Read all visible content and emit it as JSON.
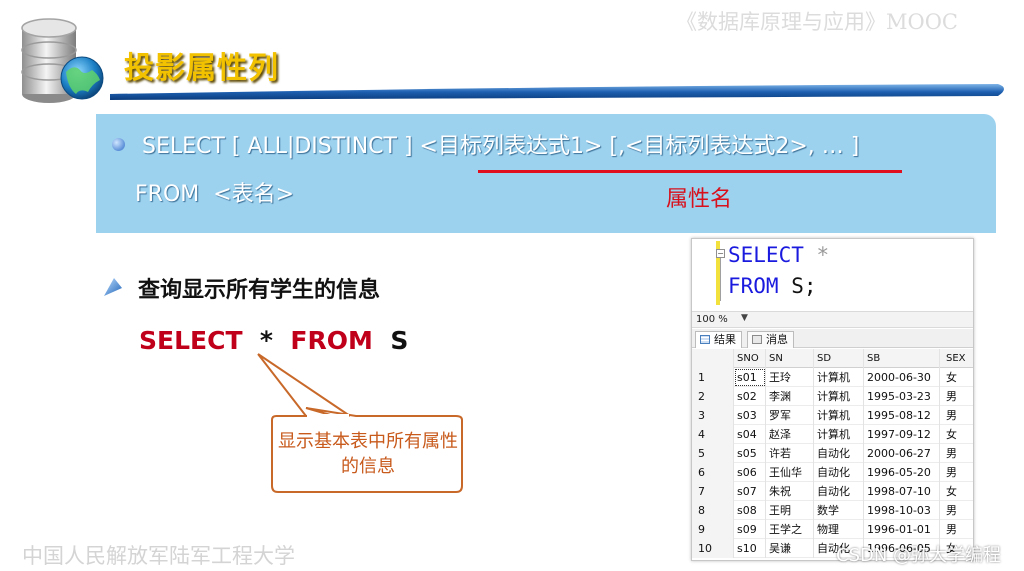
{
  "header": {
    "course_title": "《数据库原理与应用》MOOC",
    "slide_title": "投影属性列"
  },
  "syntax": {
    "line1": "SELECT [ ALL|DISTINCT ] <目标列表达式1> [,<目标列表达式2>, … ]",
    "line2": "FROM  <表名>",
    "annotation": "属性名"
  },
  "example": {
    "heading": "查询显示所有学生的信息",
    "sql_select": "SELECT",
    "sql_star": "*",
    "sql_from": "FROM",
    "sql_table": "S",
    "callout": "显示基本表中所有属性的信息"
  },
  "footer": {
    "school": "中国人民解放军陆军工程大学",
    "watermark": "CSDN @弥大学编程"
  },
  "ssms": {
    "editor": {
      "line1_kw": "SELECT",
      "line1_rest": " *",
      "line2_kw": "FROM",
      "line2_rest": " S;"
    },
    "zoom": "100 %",
    "tabs": {
      "results": "结果",
      "messages": "消息"
    },
    "columns": [
      "SNO",
      "SN",
      "SD",
      "SB",
      "SEX"
    ],
    "rows": [
      {
        "n": "1",
        "cells": [
          "s01",
          "王玲",
          "计算机",
          "2000-06-30",
          "女"
        ]
      },
      {
        "n": "2",
        "cells": [
          "s02",
          "李渊",
          "计算机",
          "1995-03-23",
          "男"
        ]
      },
      {
        "n": "3",
        "cells": [
          "s03",
          "罗军",
          "计算机",
          "1995-08-12",
          "男"
        ]
      },
      {
        "n": "4",
        "cells": [
          "s04",
          "赵泽",
          "计算机",
          "1997-09-12",
          "女"
        ]
      },
      {
        "n": "5",
        "cells": [
          "s05",
          "许若",
          "自动化",
          "2000-06-27",
          "男"
        ]
      },
      {
        "n": "6",
        "cells": [
          "s06",
          "王仙华",
          "自动化",
          "1996-05-20",
          "男"
        ]
      },
      {
        "n": "7",
        "cells": [
          "s07",
          "朱祝",
          "自动化",
          "1998-07-10",
          "女"
        ]
      },
      {
        "n": "8",
        "cells": [
          "s08",
          "王明",
          "数学",
          "1998-10-03",
          "男"
        ]
      },
      {
        "n": "9",
        "cells": [
          "s09",
          "王学之",
          "物理",
          "1996-01-01",
          "男"
        ]
      },
      {
        "n": "10",
        "cells": [
          "s10",
          "吴谦",
          "自动化",
          "1996-06-05",
          "女"
        ]
      }
    ]
  }
}
